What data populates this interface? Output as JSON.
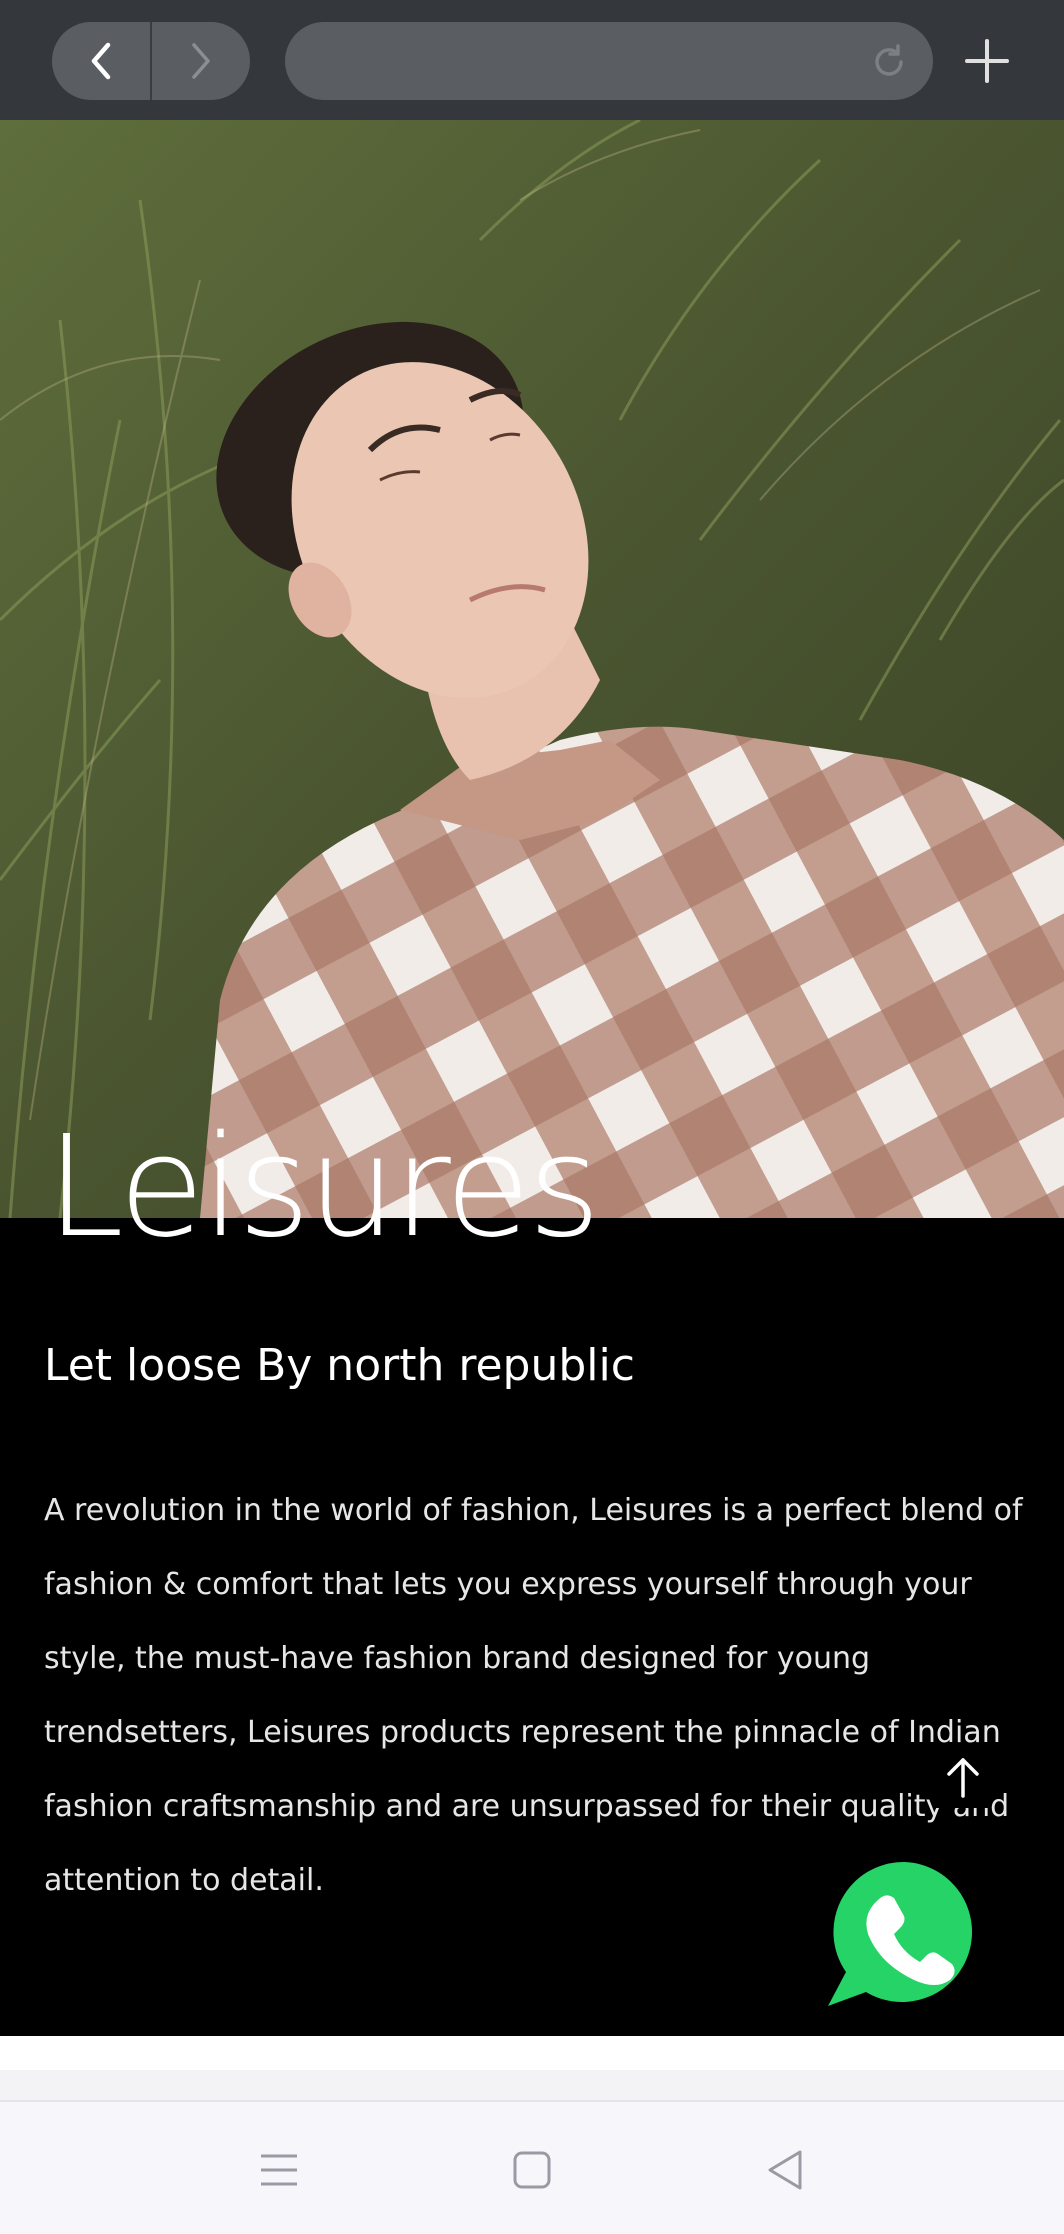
{
  "browser": {
    "url_value": "",
    "icons": [
      "back-icon",
      "forward-icon",
      "reload-icon",
      "plus-icon"
    ]
  },
  "hero": {
    "alt": "man lying in grass wearing checkered shirt"
  },
  "content": {
    "title": "Leisures",
    "tagline": "Let loose By north republic",
    "description": "A revolution in the world of fashion, Leisures is a perfect blend of fashion & comfort that lets you express yourself through your style, the must-have fashion brand designed for young trendsetters, Leisures products represent the pinnacle of Indian fashion craftsmanship and are unsurpassed for their quality and attention to detail."
  },
  "floating": {
    "scroll_top_icon": "arrow-up-icon",
    "chat_icon": "whatsapp-icon",
    "chat_color": "#25d366"
  },
  "android_nav": {
    "icons": [
      "menu-icon",
      "home-icon",
      "back-triangle-icon"
    ]
  },
  "colors": {
    "topbar": "#34373c",
    "pill": "#5a5d62",
    "text_block": "#000000",
    "nav_bar": "#f7f7fb"
  }
}
